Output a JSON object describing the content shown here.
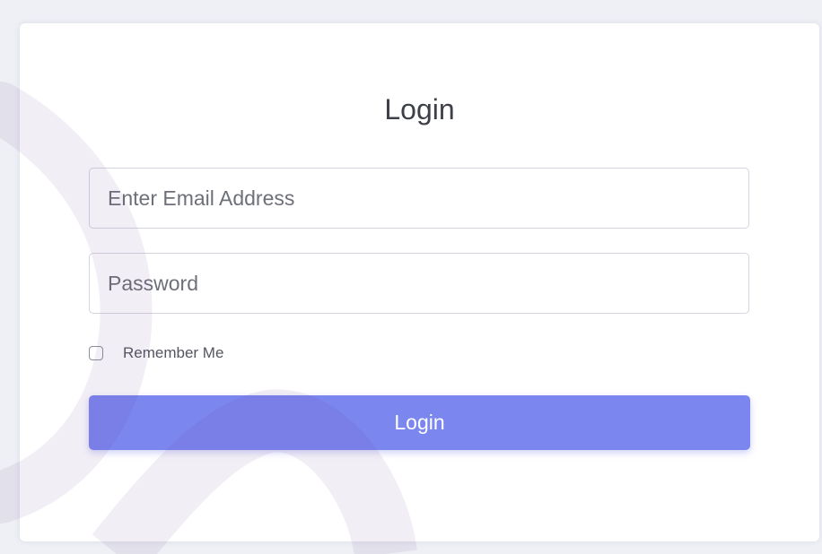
{
  "login_form": {
    "title": "Login",
    "email_placeholder": "Enter Email Address",
    "password_placeholder": "Password",
    "remember_label": "Remember Me",
    "submit_label": "Login"
  },
  "colors": {
    "button": "#7b86ef",
    "decoration": "#6a3f92",
    "background": "#eef0f5"
  }
}
